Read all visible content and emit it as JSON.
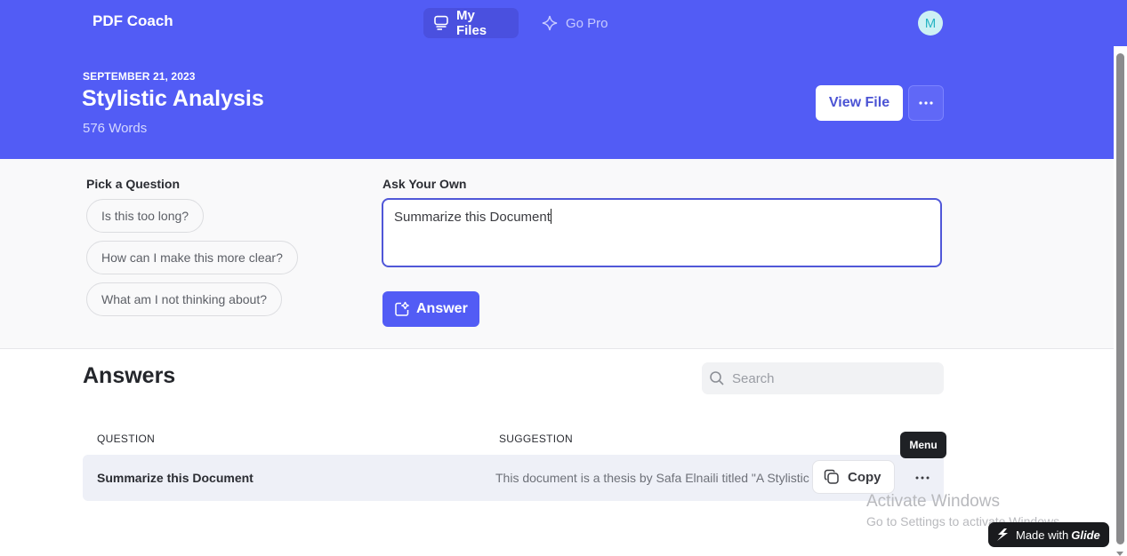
{
  "nav": {
    "brand": "PDF Coach",
    "tabs": [
      {
        "label": "My Files",
        "icon": "files-icon",
        "active": true
      },
      {
        "label": "Go Pro",
        "icon": "sparkle-icon",
        "active": false
      }
    ],
    "avatar_initial": "M"
  },
  "header": {
    "date": "SEPTEMBER 21, 2023",
    "title": "Stylistic Analysis",
    "word_count": "576 Words",
    "view_file_label": "View File",
    "more_icon": "ellipsis-icon"
  },
  "questions": {
    "pick_label": "Pick a Question",
    "options": [
      "Is this too long?",
      "How can I make this more clear?",
      "What am I not thinking about?"
    ],
    "ask_label": "Ask Your Own",
    "ask_value": "Summarize this Document",
    "answer_label": "Answer"
  },
  "answers": {
    "title": "Answers",
    "search_placeholder": "Search",
    "columns": [
      "QUESTION",
      "SUGGESTION"
    ],
    "rows": [
      {
        "question": "Summarize this Document",
        "suggestion": "This document is a thesis by Safa Elnaili titled \"A Stylistic Analysis"
      }
    ],
    "copy_label": "Copy",
    "menu_tooltip": "Menu"
  },
  "overlay": {
    "watermark_title": "Activate Windows",
    "watermark_sub": "Go to Settings to activate Windows.",
    "glide_prefix": "Made with",
    "glide_brand": "Glide"
  },
  "colors": {
    "brand": "#525cf5",
    "active_tab": "#4a50df",
    "row_bg": "#eef0f7",
    "grammarly": "#15846d"
  }
}
